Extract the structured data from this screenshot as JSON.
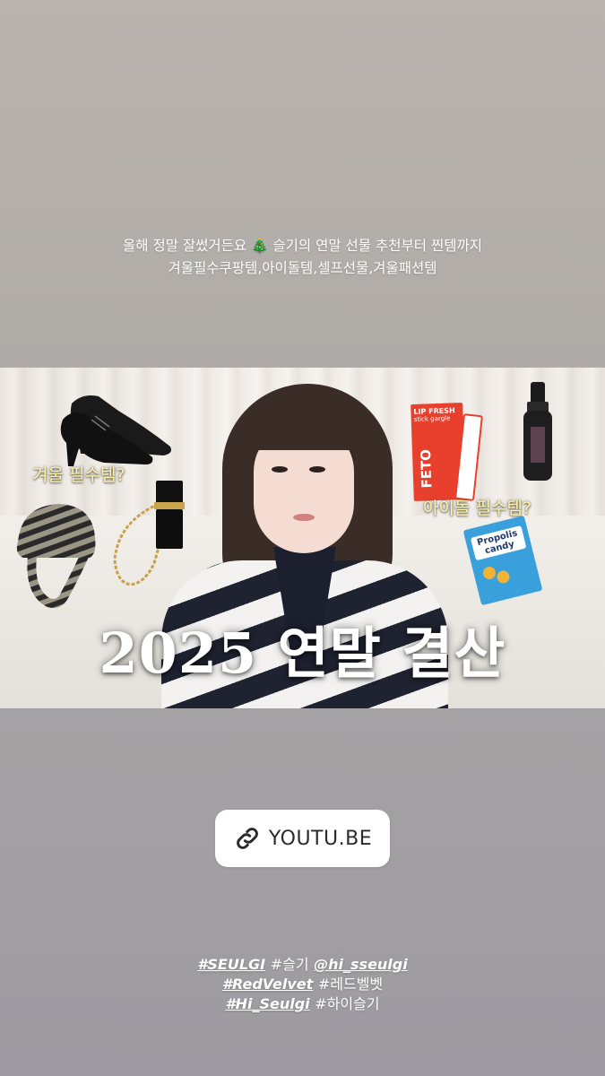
{
  "caption": {
    "line1_a": "올해 정말 잘썼거든요",
    "line1_emoji": "🎄",
    "line1_b": "슬기의 연말 선물 추천부터 찐템까지",
    "line2": "겨울필수쿠팡템,아이돌템,셀프선물,겨울패션템"
  },
  "thumbnail": {
    "label_winter": "겨울 필수템?",
    "label_idol": "아이돌 필수템?",
    "headline": "2025 연말 결산",
    "product_lip_line1": "LIP FRESH",
    "product_lip_line2": "stick gargle",
    "product_lip_brand": "FETO",
    "product_candy_line1": "Propolis",
    "product_candy_line2": "candy"
  },
  "link": {
    "icon": "link-icon",
    "label": "YOUTU.BE"
  },
  "tags": {
    "row1": [
      "#SEULGI",
      "#슬기",
      "@hi_sseulgi"
    ],
    "row2": [
      "#RedVelvet",
      "#레드벨벳"
    ],
    "row3": [
      "#Hi_Seulgi",
      "#하이슬기"
    ]
  }
}
